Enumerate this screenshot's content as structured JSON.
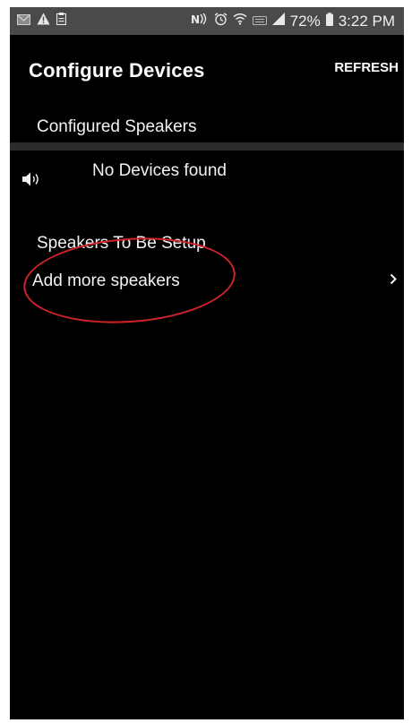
{
  "status_bar": {
    "battery_text": "72%",
    "time": "3:22 PM",
    "icons_left": [
      "mail-icon",
      "warning-icon",
      "clipboard-icon"
    ],
    "icons_right": [
      "nfc-icon",
      "alarm-icon",
      "wifi-icon",
      "volte-icon",
      "signal-icon",
      "battery-icon"
    ]
  },
  "appbar": {
    "title": "Configure Devices",
    "refresh_label": "REFRESH"
  },
  "configured": {
    "header": "Configured Speakers",
    "empty_text": "No Devices found",
    "icon": "speaker-icon"
  },
  "setup": {
    "header": "Speakers To Be Setup",
    "add_label": "Add more speakers",
    "chevron_icon": "chevron-right-icon"
  },
  "colors": {
    "background": "#000000",
    "status_bar": "#4a4a4a",
    "text": "#f2f2f2",
    "annotation_circle": "#d0232b"
  }
}
